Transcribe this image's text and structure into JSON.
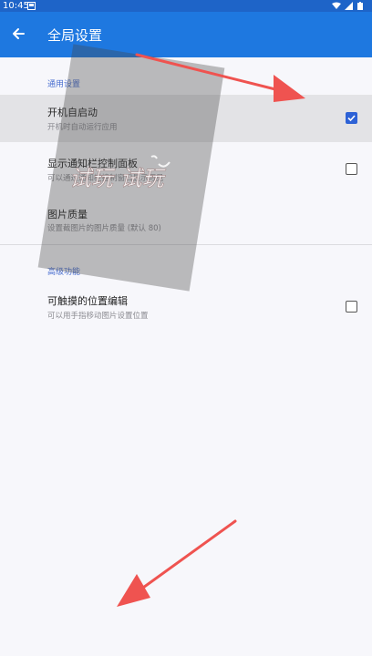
{
  "status": {
    "time": "10:45"
  },
  "appbar": {
    "title": "全局设置"
  },
  "sections": [
    {
      "header": "通用设置"
    },
    {
      "header": "高级功能"
    }
  ],
  "settings": [
    {
      "title": "开机自启动",
      "subtitle": "开机时自动运行应用",
      "checked": true
    },
    {
      "title": "显示通知栏控制面板",
      "subtitle": "可以通过通知栏控制窗口显示可见",
      "checked": false
    },
    {
      "title": "图片质量",
      "subtitle": "设置截图片的图片质量 (默认 80)"
    },
    {
      "title": "可触摸的位置编辑",
      "subtitle": "可以用手指移动图片设置位置",
      "checked": false
    }
  ],
  "watermark_text": "试玩 试玩",
  "colors": {
    "appbar": "#1e78e0",
    "statusbar": "#1e64c8",
    "accent": "#2e62d6",
    "arrow": "#ef5350"
  }
}
